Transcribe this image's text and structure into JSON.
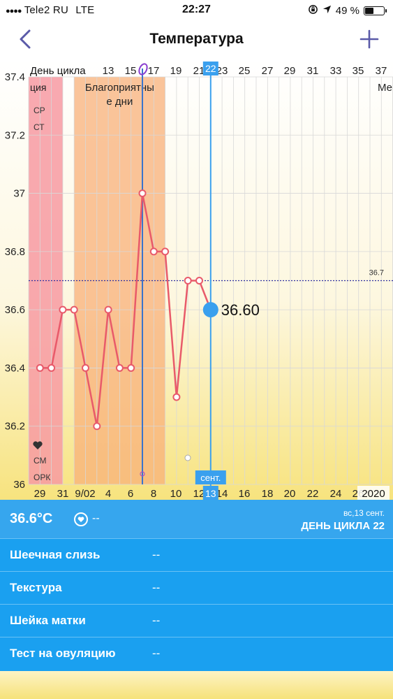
{
  "status_bar": {
    "carrier": "Tele2 RU",
    "network": "LTE",
    "time": "22:27",
    "battery": "49 %",
    "battery_level": 0.49
  },
  "nav": {
    "title": "Температура"
  },
  "chart_data": {
    "type": "line",
    "ylim": [
      36,
      37.4
    ],
    "y_ticks": [
      "37.4",
      "37.2",
      "37",
      "36.8",
      "36.6",
      "36.4",
      "36.2",
      "36"
    ],
    "cycle_day_label": "День цикла",
    "cycle_day_ticks": [
      "13",
      "15",
      "17",
      "19",
      "21",
      "22",
      "23",
      "25",
      "27",
      "29",
      "31",
      "33",
      "35",
      "37"
    ],
    "date_ticks": [
      "29",
      "31",
      "9/02",
      "4",
      "6",
      "8",
      "10",
      "12",
      "13",
      "14",
      "16",
      "18",
      "20",
      "22",
      "24",
      "26"
    ],
    "date_year": "2020",
    "x_start": "2020-08-28",
    "temperatures": [
      {
        "date": "2020-08-29",
        "value": 36.4
      },
      {
        "date": "2020-08-30",
        "value": 36.4
      },
      {
        "date": "2020-08-31",
        "value": 36.6
      },
      {
        "date": "2020-09-01",
        "value": 36.6
      },
      {
        "date": "2020-09-02",
        "value": 36.4
      },
      {
        "date": "2020-09-03",
        "value": 36.2
      },
      {
        "date": "2020-09-04",
        "value": 36.6
      },
      {
        "date": "2020-09-05",
        "value": 36.4
      },
      {
        "date": "2020-09-06",
        "value": 36.4
      },
      {
        "date": "2020-09-07",
        "value": 37.0
      },
      {
        "date": "2020-09-08",
        "value": 36.8
      },
      {
        "date": "2020-09-09",
        "value": 36.8
      },
      {
        "date": "2020-09-10",
        "value": 36.3
      },
      {
        "date": "2020-09-11",
        "value": 36.7
      },
      {
        "date": "2020-09-12",
        "value": 36.7
      },
      {
        "date": "2020-09-13",
        "value": 36.6
      }
    ],
    "coverline": {
      "value": 36.7,
      "label": "36.7"
    },
    "period": {
      "label": "ция",
      "notes": [
        "СР",
        "СТ"
      ],
      "bottom_notes": [
        "СМ",
        "ОРК"
      ],
      "from": "2020-08-28",
      "to": "2020-08-30"
    },
    "fertile": {
      "label": "Благоприятные дни",
      "from": "2020-09-02",
      "to": "2020-09-09"
    },
    "ovulation_date": "2020-09-07",
    "selected": {
      "date": "2020-09-13",
      "value": 36.6,
      "value_label": "36.60",
      "day": "13",
      "cycle_day": "22",
      "month_label": "сент."
    },
    "right_edge_label": "Ме",
    "colors": {
      "line": "#e85a6a",
      "period": "#f79aa2",
      "fertile": "#f8b07a",
      "ovulation": "#3a74cc",
      "selected": "#3aa0ee",
      "coverline": "#3030a0"
    }
  },
  "panel": {
    "temperature": "36.6°C",
    "mood_value": "--",
    "date": "вс,13 сент.",
    "cycle_day": "ДЕНЬ ЦИКЛА 22",
    "rows": [
      {
        "label": "Шеечная слизь",
        "value": "--"
      },
      {
        "label": "Текстура",
        "value": "--"
      },
      {
        "label": "Шейка матки",
        "value": "--"
      },
      {
        "label": "Тест на овуляцию",
        "value": "--"
      }
    ]
  }
}
